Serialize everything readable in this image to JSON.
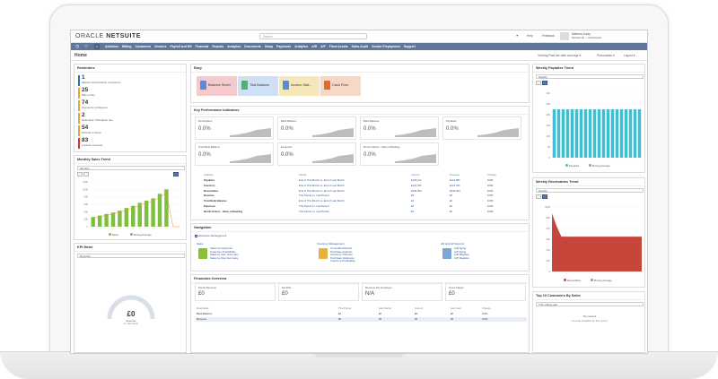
{
  "app": {
    "logo_a": "ORACLE",
    "logo_b": "NETSUITE",
    "search_placeholder": "Search"
  },
  "topbar": {
    "help": "Help",
    "feedback": "Feedback",
    "user_name": "Matthew Daley",
    "user_role": "NetSuite UK — Administrator"
  },
  "nav": {
    "items": [
      "Activities",
      "Billing",
      "Customers",
      "Vendors",
      "Payroll and HR",
      "Financial",
      "Reports",
      "Analytics",
      "Documents",
      "Setup",
      "Payments",
      "Analytics",
      "A/R",
      "A/P",
      "Fixed Assets",
      "Sales Audit",
      "Vendor Prepayment",
      "Support"
    ]
  },
  "page": {
    "title": "Home",
    "link1": "Viewing Past bar date and tags ▾",
    "link2": "Personalize ▾",
    "link3": "Layout ▾"
  },
  "reminders": {
    "title": "Reminders",
    "items": [
      {
        "num": "1",
        "label": "Matters Authorization to Approve",
        "color": "#2c6fb7"
      },
      {
        "num": "25",
        "label": "Bills to Pay",
        "color": "#e8a531"
      },
      {
        "num": "74",
        "label": "Payments to Request",
        "color": "#e8a531"
      },
      {
        "num": "2",
        "label": "Relocation Schedules due",
        "color": "#e8a531"
      },
      {
        "num": "54",
        "label": "Periods to Close",
        "color": "#e8a531"
      },
      {
        "num": "83",
        "label": "Invoices Overdue",
        "color": "#cc3333"
      }
    ]
  },
  "monthly_sales": {
    "title": "Monthly Sales Trend",
    "dd": "Monthly",
    "legend1": "Sales",
    "legend2": "Moving Average"
  },
  "kpi_meter": {
    "title": "KPI Meter",
    "dd": "Revenue",
    "value": "£0",
    "sub": "Revenue",
    "sub2": "vs. last period"
  },
  "shortcuts": {
    "title": "Navigation",
    "tiles_title": "Easy",
    "tiles": [
      {
        "label": "Balance Sheet",
        "bg": "#f6c9cc",
        "ico": "#5b8bd8"
      },
      {
        "label": "Trial Balance",
        "bg": "#cfe0f4",
        "ico": "#4db36a"
      },
      {
        "label": "Income Stat...",
        "bg": "#f4e7b8",
        "ico": "#5b8bd8"
      },
      {
        "label": "Cash Flow",
        "bg": "#f7d8c5",
        "ico": "#e06a2c"
      }
    ]
  },
  "kpis": {
    "title": "Key Performance Indicators",
    "boxes": [
      {
        "label": "Receivables",
        "value": "0.0%"
      },
      {
        "label": "Bank Balance",
        "value": "0.0%"
      },
      {
        "label": "Bank Balance",
        "value": "0.0%"
      },
      {
        "label": "Payables",
        "value": "0.0%"
      },
      {
        "label": "Total Bank Balance",
        "value": "0.0%"
      },
      {
        "label": "Expenses",
        "value": "0.0%"
      },
      {
        "label": "Month Orders - Value of Backlog",
        "value": "0.0%"
      }
    ],
    "table_headers": [
      "Indicator",
      "Period",
      "Current",
      "Previous",
      "Change"
    ],
    "rows": [
      [
        "Payables",
        "End of This Month vs. End of Last Month",
        "£225,141",
        "£224,881",
        "0.0%"
      ],
      [
        "Inventory",
        "End of This Month vs. End of Last Month",
        "£213,781",
        "£213,781",
        "0.0%"
      ],
      [
        "Receivables",
        "End of This Month vs. End of Last Month",
        "£546,964",
        "£546,964",
        "0.0%"
      ],
      [
        "Revenue",
        "This Period vs. Last Period",
        "£0",
        "£0",
        "0.0%"
      ],
      [
        "Total Bank Balance",
        "End of This Month vs. End of Last Month",
        "£0",
        "£0",
        "0.0%"
      ],
      [
        "Expenses",
        "This Period vs. Last Period",
        "£0",
        "£0",
        "0.0%"
      ],
      [
        "Month Orders - Value of Backlog",
        "This Period vs. Last Period",
        "£0",
        "£0",
        "0.0%"
      ]
    ]
  },
  "navigation": {
    "title": "Navigation",
    "exec": "Executive Management",
    "col1_title": "Sales",
    "col1": [
      "Sales by Customer",
      "Customer Profitability",
      "Sales by Item Summary",
      "Sales by Rep Summary"
    ],
    "col2_title": "Inventory Management",
    "col2": [
      "Committed Report",
      "Purchase Analysis",
      "Inventory Turnover",
      "Purchase Variances",
      "Inventory Profitability"
    ],
    "col3_title": "AR and AP Reports",
    "col3": [
      "A/R Aging",
      "A/P Aging",
      "A/R Register",
      "A/P Register"
    ]
  },
  "financials": {
    "title": "Financials Overview",
    "boxes": [
      {
        "label": "Period Revenue",
        "value": "£0"
      },
      {
        "label": "Net P&L",
        "value": "£0"
      },
      {
        "label": "Revenue Per Employee",
        "value": "N/A"
      },
      {
        "label": "Gross Margin",
        "value": "£0"
      }
    ],
    "headers": [
      "Description",
      "This Period",
      "Last Period",
      "Current",
      "Last Year",
      "Change"
    ],
    "rows": [
      [
        "Bank Balance",
        "£0",
        "£0",
        "£0",
        "£0",
        "0.0%"
      ],
      [
        "Revenue",
        "£0",
        "£0",
        "£0",
        "£0",
        "0.0%"
      ]
    ]
  },
  "weekly_payables": {
    "title": "Weekly Payables Trend",
    "dd": "Weekly",
    "legend1": "Payables",
    "legend2": "Moving Average"
  },
  "weekly_receivables": {
    "title": "Weekly Receivables Trend",
    "dd": "Weekly",
    "legend1": "Receivables",
    "legend2": "Moving Average"
  },
  "top_customers": {
    "title": "Top 10 Customers By Sales",
    "dd": "This rolling year",
    "empty1": "No content",
    "empty2": "No data available for this period"
  },
  "colors": {
    "nav": "#607799",
    "bar_green": "#7fbf3f",
    "bar_teal": "#3fbfcf",
    "area_red": "#c7463b"
  },
  "chart_data": [
    {
      "type": "bar",
      "title": "Monthly Sales Trend",
      "categories": [
        "1",
        "2",
        "3",
        "4",
        "5",
        "6",
        "7",
        "8",
        "9",
        "10",
        "11",
        "12",
        "13",
        "14"
      ],
      "series": [
        {
          "name": "Sales",
          "values": [
            260,
            300,
            340,
            380,
            430,
            500,
            560,
            640,
            700,
            760,
            880,
            1000,
            0,
            0
          ]
        }
      ],
      "ylim": [
        0,
        1200
      ]
    },
    {
      "type": "bar",
      "title": "Weekly Payables Trend",
      "categories": [
        "1",
        "2",
        "3",
        "4",
        "5",
        "6",
        "7",
        "8",
        "9",
        "10",
        "11",
        "12",
        "13",
        "14",
        "15",
        "16",
        "17",
        "18",
        "19",
        "20"
      ],
      "series": [
        {
          "name": "Payables",
          "values": [
            225,
            225,
            225,
            225,
            225,
            225,
            225,
            225,
            225,
            225,
            225,
            225,
            225,
            225,
            225,
            225,
            225,
            225,
            225,
            225
          ]
        }
      ],
      "ylim": [
        0,
        300
      ]
    },
    {
      "type": "area",
      "title": "Weekly Receivables Trend",
      "x": [
        "1",
        "2",
        "3",
        "4",
        "5",
        "6",
        "7",
        "8",
        "9",
        "10",
        "11",
        "12",
        "13",
        "14",
        "15",
        "16",
        "17",
        "18",
        "19",
        "20"
      ],
      "series": [
        {
          "name": "Receivables",
          "values": [
            900,
            700,
            540,
            540,
            540,
            540,
            540,
            540,
            540,
            540,
            540,
            540,
            540,
            540,
            540,
            540,
            540,
            540,
            540,
            540
          ]
        }
      ],
      "ylim": [
        0,
        1000
      ]
    }
  ]
}
